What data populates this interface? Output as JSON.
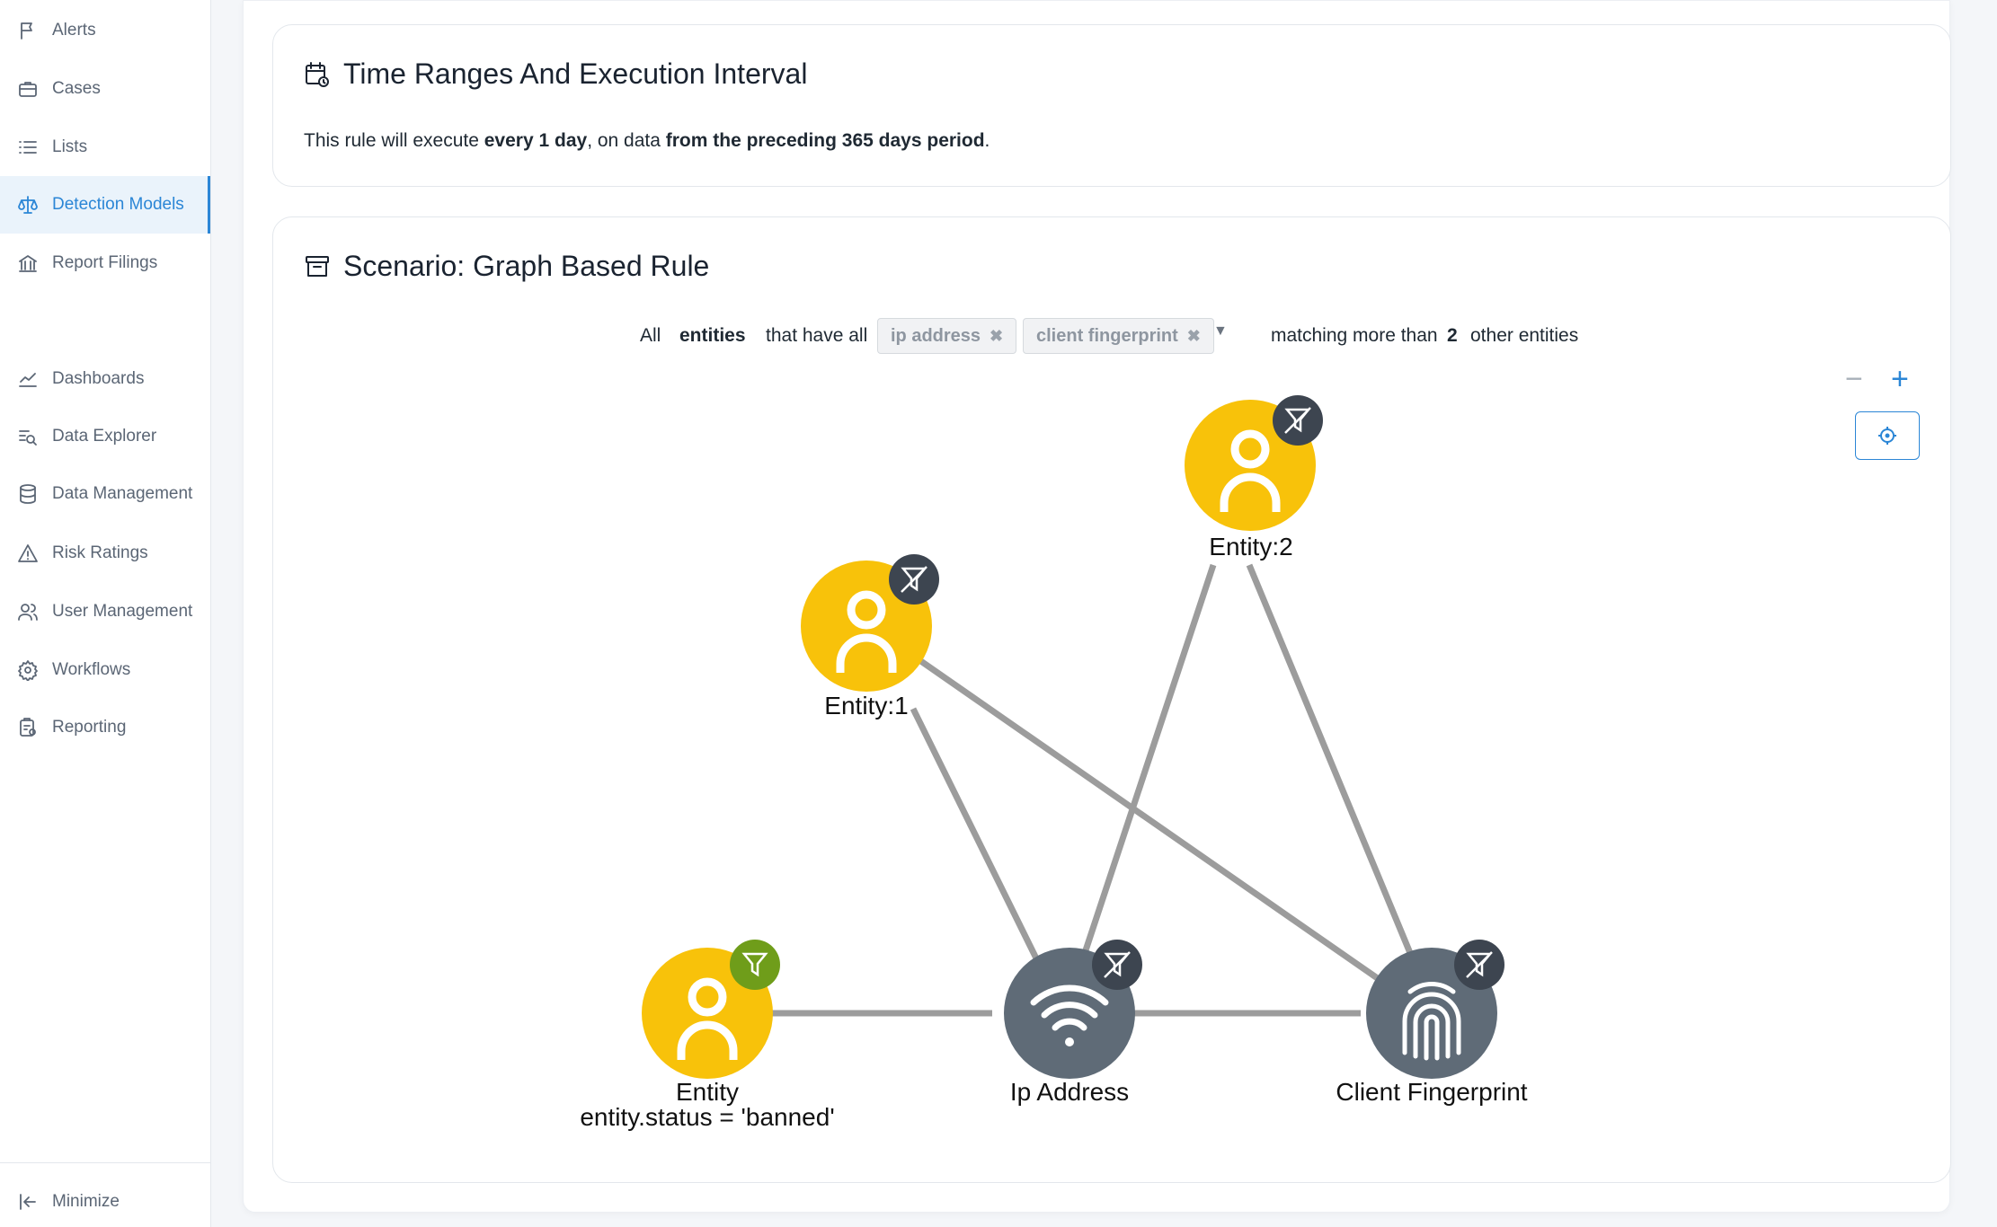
{
  "sidebar": {
    "items": [
      {
        "label": "Alerts",
        "icon": "flag-icon"
      },
      {
        "label": "Cases",
        "icon": "briefcase-icon"
      },
      {
        "label": "Lists",
        "icon": "list-icon"
      },
      {
        "label": "Detection Models",
        "icon": "scale-icon",
        "active": true
      },
      {
        "label": "Report Filings",
        "icon": "bank-icon"
      },
      {
        "label": "Dashboards",
        "icon": "line-chart-icon"
      },
      {
        "label": "Data Explorer",
        "icon": "search-list-icon"
      },
      {
        "label": "Data Management",
        "icon": "database-icon"
      },
      {
        "label": "Risk Ratings",
        "icon": "warning-icon"
      },
      {
        "label": "User Management",
        "icon": "users-icon"
      },
      {
        "label": "Workflows",
        "icon": "gear-icon"
      },
      {
        "label": "Reporting",
        "icon": "clipboard-icon"
      }
    ],
    "minimize_label": "Minimize"
  },
  "time_panel": {
    "title": "Time Ranges And Execution Interval",
    "text_prefix": "This rule will execute ",
    "text_interval": "every 1 day",
    "text_middle": ", on data ",
    "text_period": "from the preceding 365 days period",
    "text_suffix": "."
  },
  "scenario_panel": {
    "title": "Scenario: Graph Based Rule",
    "query": {
      "all": "All",
      "entities": "entities",
      "that_have_all": "that have all",
      "chips": [
        "ip address",
        "client fingerprint"
      ],
      "matching": "matching more than",
      "count": "2",
      "other": "other entities"
    },
    "zoom_out": "−",
    "zoom_in": "+"
  },
  "graph": {
    "nodes": [
      {
        "id": "entity2",
        "label": "Entity:2",
        "kind": "person",
        "badge": "filter-off"
      },
      {
        "id": "entity1",
        "label": "Entity:1",
        "kind": "person",
        "badge": "filter-off"
      },
      {
        "id": "entity",
        "label": "Entity",
        "sublabel": "entity.status = 'banned'",
        "kind": "person",
        "badge": "filter-on"
      },
      {
        "id": "ip",
        "label": "Ip Address",
        "kind": "wifi",
        "badge": "filter-off"
      },
      {
        "id": "fp",
        "label": "Client Fingerprint",
        "kind": "fingerprint",
        "badge": "filter-off"
      }
    ],
    "edges": [
      [
        "entity1",
        "ip"
      ],
      [
        "entity1",
        "fp"
      ],
      [
        "entity2",
        "ip"
      ],
      [
        "entity2",
        "fp"
      ],
      [
        "entity",
        "ip"
      ],
      [
        "ip",
        "fp"
      ]
    ],
    "colors": {
      "person": "#f8c20a",
      "device": "#5f6b77",
      "badge_off": "#3d4550",
      "badge_on": "#6f9d1a",
      "edge": "#9c9c9c"
    }
  }
}
